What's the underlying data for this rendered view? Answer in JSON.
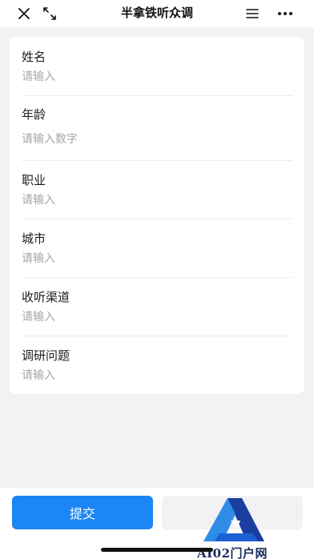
{
  "window": {
    "title": "半拿铁听众调",
    "close_icon": "close-icon",
    "expand_icon": "expand-icon",
    "menu_icon": "menu-icon",
    "more_icon": "more-icon"
  },
  "form": {
    "fields": [
      {
        "label": "姓名",
        "placeholder": "请输入",
        "value": ""
      },
      {
        "label": "年龄",
        "placeholder": "请输入数字",
        "value": ""
      },
      {
        "label": "职业",
        "placeholder": "请输入",
        "value": ""
      },
      {
        "label": "城市",
        "placeholder": "请输入",
        "value": ""
      },
      {
        "label": "收听渠道",
        "placeholder": "请输入",
        "value": ""
      },
      {
        "label": "调研问题",
        "placeholder": "请输入",
        "value": ""
      }
    ]
  },
  "footer": {
    "submit_label": "提交"
  },
  "watermark": {
    "text": "AI02门户网"
  },
  "colors": {
    "accent": "#1c86f5",
    "background": "#f2f2f4",
    "placeholder": "#a6a6a6"
  }
}
